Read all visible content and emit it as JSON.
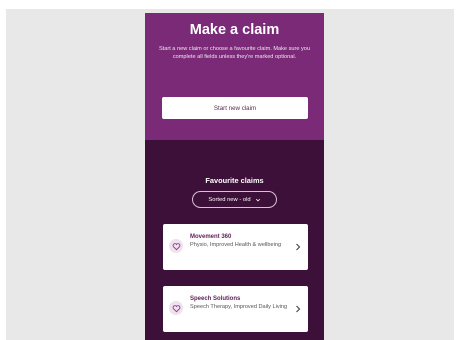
{
  "hero": {
    "title": "Make a claim",
    "description": "Start a new claim or choose a favourite claim. Make sure you complete all fields unless they're marked optional.",
    "start_button": "Start new claim"
  },
  "favourites": {
    "title": "Favourite claims",
    "sort_label": "Sorted new - old",
    "items": [
      {
        "name": "Movement 360",
        "description": "Physio, Improved Health & wellbeing"
      },
      {
        "name": "Speech Solutions",
        "description": "Speech Therapy, Improved Daily Living"
      }
    ]
  },
  "icons": {
    "card_icon": "heart-icon",
    "card_chevron": "chevron-right-icon",
    "sort_chevron": "chevron-down-icon"
  },
  "colors": {
    "hero_bg": "#7b2a78",
    "page_bg": "#3d1039",
    "accent_text": "#5c1f58"
  }
}
